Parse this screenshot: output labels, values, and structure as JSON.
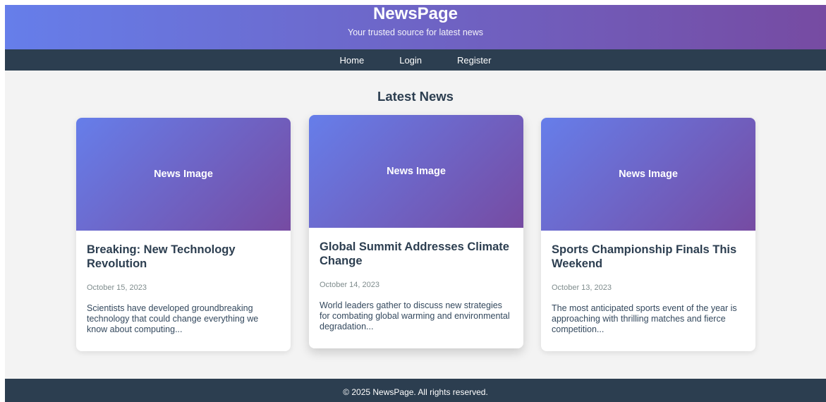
{
  "header": {
    "site_title": "NewsPage",
    "tagline": "Your trusted source for latest news"
  },
  "nav": {
    "items": [
      {
        "label": "Home"
      },
      {
        "label": "Login"
      },
      {
        "label": "Register"
      }
    ]
  },
  "main": {
    "section_title": "Latest News",
    "cards": [
      {
        "image_label": "News Image",
        "title": "Breaking: New Technology Revolution",
        "date": "October 15, 2023",
        "excerpt": "Scientists have developed groundbreaking technology that could change everything we know about computing..."
      },
      {
        "image_label": "News Image",
        "title": "Global Summit Addresses Climate Change",
        "date": "October 14, 2023",
        "excerpt": "World leaders gather to discuss new strategies for combating global warming and environmental degradation..."
      },
      {
        "image_label": "News Image",
        "title": "Sports Championship Finals This Weekend",
        "date": "October 13, 2023",
        "excerpt": "The most anticipated sports event of the year is approaching with thrilling matches and fierce competition..."
      }
    ]
  },
  "footer": {
    "text": "© 2025 NewsPage. All rights reserved."
  },
  "colors": {
    "gradient_start": "#667eea",
    "gradient_end": "#764ba2",
    "nav_background": "#2c3e50",
    "page_background": "#f3f3f3"
  }
}
